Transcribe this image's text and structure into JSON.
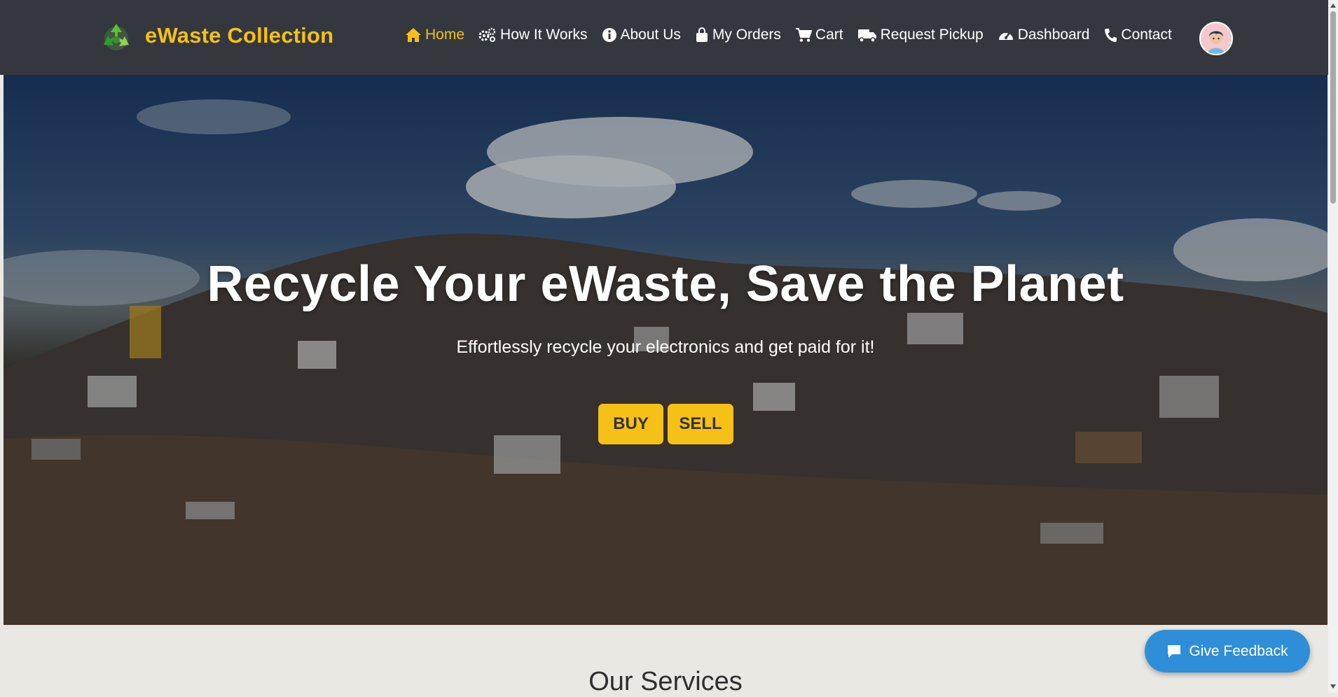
{
  "brand": {
    "name": "eWaste Collection",
    "logo_icon": "recycle-icon"
  },
  "nav": {
    "items": [
      {
        "label": "Home",
        "icon": "home-icon",
        "active": true
      },
      {
        "label": "How It Works",
        "icon": "gears-icon",
        "active": false
      },
      {
        "label": "About Us",
        "icon": "info-icon",
        "active": false
      },
      {
        "label": "My Orders",
        "icon": "shopping-bag-icon",
        "active": false
      },
      {
        "label": "Cart",
        "icon": "cart-icon",
        "active": false
      },
      {
        "label": "Request Pickup",
        "icon": "truck-icon",
        "active": false
      },
      {
        "label": "Dashboard",
        "icon": "gauge-icon",
        "active": false
      },
      {
        "label": "Contact",
        "icon": "phone-icon",
        "active": false
      }
    ]
  },
  "hero": {
    "title": "Recycle Your eWaste, Save the Planet",
    "subtitle": "Effortlessly recycle your electronics and get paid for it!",
    "buy_label": "BUY",
    "sell_label": "SELL"
  },
  "services": {
    "title": "Our Services"
  },
  "feedback": {
    "label": "Give Feedback",
    "icon": "chat-icon"
  },
  "colors": {
    "accent": "#f6c017",
    "navbar_bg": "#34383e",
    "feedback_bg": "#2e8fd8",
    "section_bg": "#e9e8e2"
  }
}
